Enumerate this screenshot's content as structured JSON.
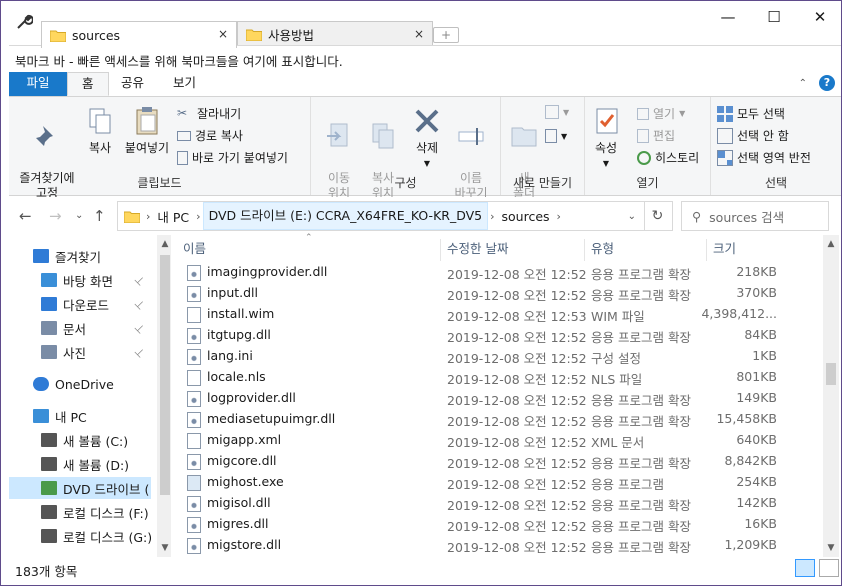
{
  "window": {
    "tabs": [
      {
        "label": "sources",
        "active": true
      },
      {
        "label": "사용방법",
        "active": false
      }
    ],
    "close_tab_glyph": "×",
    "new_tab_glyph": "+",
    "minimize_glyph": "—",
    "maximize_glyph": "☐",
    "close_glyph": "✕"
  },
  "bookmark_bar": {
    "text": "북마크 바 - 빠른 액세스를 위해 북마크들을 여기에 표시합니다."
  },
  "ribbon_tabs": [
    "파일",
    "홈",
    "공유",
    "보기"
  ],
  "ribbon": {
    "clipboard": {
      "label": "클립보드",
      "pin": "즐겨찾기에\n고정",
      "copy": "복사",
      "paste": "붙여넣기",
      "cut": "잘라내기",
      "copy_path": "경로 복사",
      "paste_shortcut": "바로 가기 붙여넣기"
    },
    "organize": {
      "label": "구성",
      "move_to": "이동\n위치",
      "copy_to": "복사\n위치",
      "delete": "삭제",
      "rename": "이름\n바꾸기"
    },
    "new": {
      "label": "새로 만들기",
      "new_folder": "새\n폴더"
    },
    "open": {
      "label": "열기",
      "properties": "속성",
      "open": "열기",
      "edit": "편집",
      "history": "히스토리"
    },
    "select": {
      "label": "선택",
      "select_all": "모두 선택",
      "select_none": "선택 안 함",
      "invert": "선택 영역 반전"
    }
  },
  "address": {
    "crumbs": [
      "내 PC",
      "DVD 드라이브 (E:) CCRA_X64FRE_KO-KR_DV5",
      "sources"
    ],
    "search_placeholder": "sources 검색"
  },
  "nav_pane": {
    "items": [
      {
        "label": "즐겨찾기",
        "icon": "star-icon",
        "level": 0,
        "pinned": false
      },
      {
        "label": "바탕 화면",
        "icon": "desktop-icon",
        "level": 1,
        "pinned": true
      },
      {
        "label": "다운로드",
        "icon": "download-icon",
        "level": 1,
        "pinned": true
      },
      {
        "label": "문서",
        "icon": "document-icon",
        "level": 1,
        "pinned": true
      },
      {
        "label": "사진",
        "icon": "picture-icon",
        "level": 1,
        "pinned": true
      },
      {
        "label": "OneDrive",
        "icon": "cloud-icon",
        "level": 0,
        "pinned": false
      },
      {
        "label": "내 PC",
        "icon": "computer-icon",
        "level": 0,
        "pinned": false
      },
      {
        "label": "새 볼륨 (C:)",
        "icon": "drive-icon",
        "level": 1,
        "pinned": false
      },
      {
        "label": "새 볼륨 (D:)",
        "icon": "drive-icon",
        "level": 1,
        "pinned": false
      },
      {
        "label": "DVD 드라이브 (",
        "icon": "dvd-icon",
        "level": 1,
        "pinned": false,
        "selected": true
      },
      {
        "label": "로컬 디스크 (F:)",
        "icon": "drive-icon",
        "level": 1,
        "pinned": false
      },
      {
        "label": "로컬 디스크 (G:)",
        "icon": "drive-icon",
        "level": 1,
        "pinned": false
      }
    ],
    "pin_glyph": "📌"
  },
  "columns": {
    "name": "이름",
    "date": "수정한 날짜",
    "type": "유형",
    "size": "크기"
  },
  "files": [
    {
      "name": "imagingprovider.dll",
      "date": "2019-12-08 오전 12:52",
      "type": "응용 프로그램 확장",
      "size": "218KB",
      "icon": "dll-icon"
    },
    {
      "name": "input.dll",
      "date": "2019-12-08 오전 12:52",
      "type": "응용 프로그램 확장",
      "size": "370KB",
      "icon": "dll-icon"
    },
    {
      "name": "install.wim",
      "date": "2019-12-08 오전 12:53",
      "type": "WIM 파일",
      "size": "4,398,412...",
      "icon": "file-icon"
    },
    {
      "name": "itgtupg.dll",
      "date": "2019-12-08 오전 12:52",
      "type": "응용 프로그램 확장",
      "size": "84KB",
      "icon": "dll-icon"
    },
    {
      "name": "lang.ini",
      "date": "2019-12-08 오전 12:52",
      "type": "구성 설정",
      "size": "1KB",
      "icon": "ini-icon"
    },
    {
      "name": "locale.nls",
      "date": "2019-12-08 오전 12:52",
      "type": "NLS 파일",
      "size": "801KB",
      "icon": "file-icon"
    },
    {
      "name": "logprovider.dll",
      "date": "2019-12-08 오전 12:52",
      "type": "응용 프로그램 확장",
      "size": "149KB",
      "icon": "dll-icon"
    },
    {
      "name": "mediasetupuimgr.dll",
      "date": "2019-12-08 오전 12:52",
      "type": "응용 프로그램 확장",
      "size": "15,458KB",
      "icon": "dll-icon"
    },
    {
      "name": "migapp.xml",
      "date": "2019-12-08 오전 12:52",
      "type": "XML 문서",
      "size": "640KB",
      "icon": "file-icon"
    },
    {
      "name": "migcore.dll",
      "date": "2019-12-08 오전 12:52",
      "type": "응용 프로그램 확장",
      "size": "8,842KB",
      "icon": "dll-icon"
    },
    {
      "name": "mighost.exe",
      "date": "2019-12-08 오전 12:52",
      "type": "응용 프로그램",
      "size": "254KB",
      "icon": "exe-icon"
    },
    {
      "name": "migisol.dll",
      "date": "2019-12-08 오전 12:52",
      "type": "응용 프로그램 확장",
      "size": "142KB",
      "icon": "dll-icon"
    },
    {
      "name": "migres.dll",
      "date": "2019-12-08 오전 12:52",
      "type": "응용 프로그램 확장",
      "size": "16KB",
      "icon": "dll-icon"
    },
    {
      "name": "migstore.dll",
      "date": "2019-12-08 오전 12:52",
      "type": "응용 프로그램 확장",
      "size": "1,209KB",
      "icon": "dll-icon"
    }
  ],
  "status": {
    "item_count": "183개 항목"
  },
  "colors": {
    "accent": "#1979ca",
    "selection": "#cce8ff",
    "folder": "#ffd75e"
  }
}
